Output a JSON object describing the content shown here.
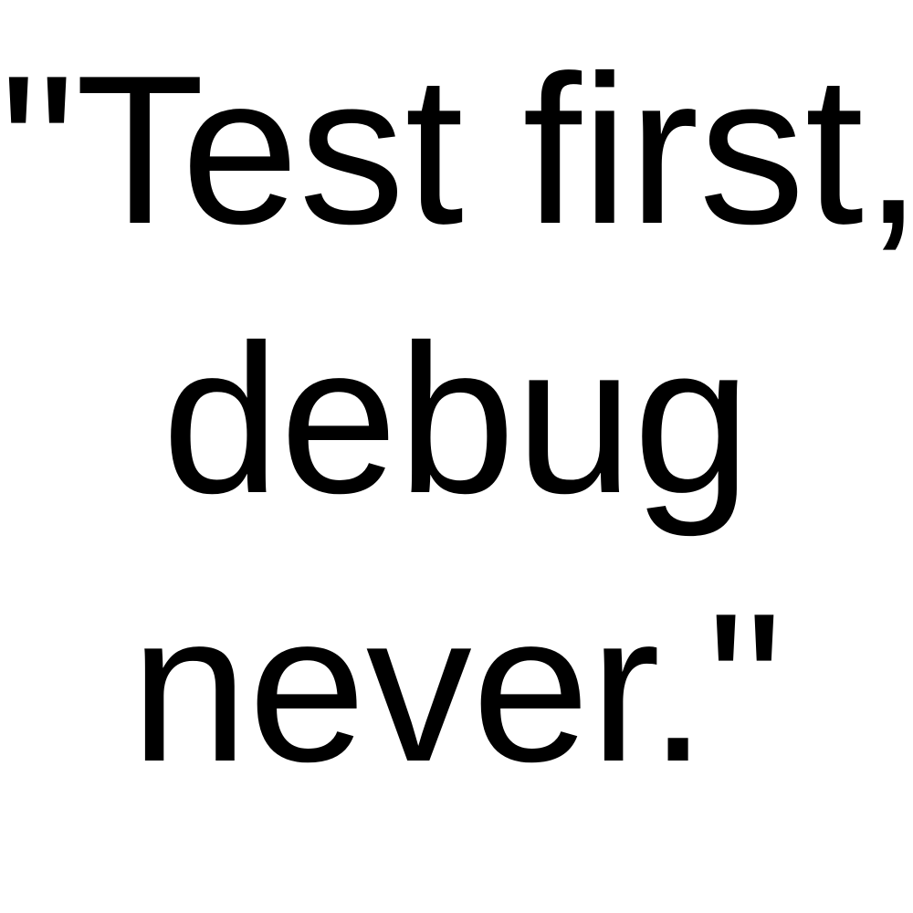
{
  "quote": {
    "lines": [
      "\"Test first,",
      "debug",
      "never.\""
    ],
    "text_color": "#000000",
    "background_color": "#ffffff"
  }
}
